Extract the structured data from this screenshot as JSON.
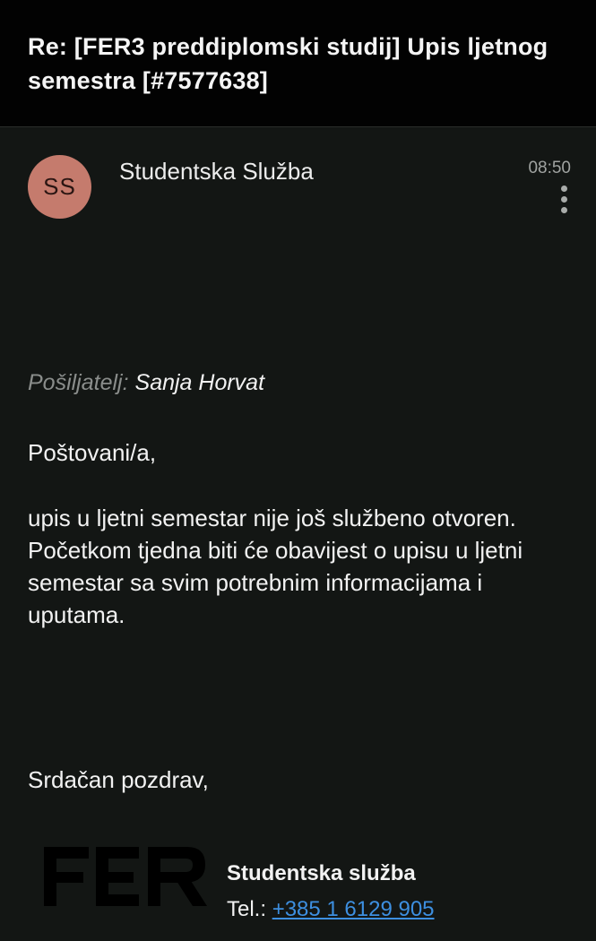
{
  "header": {
    "subject_line1": "Re: [FER3 preddiplomski studij] Upis ljetnog",
    "subject_line2": "semestra [#7577638]"
  },
  "message": {
    "avatar_initials": "SS",
    "avatar_color": "#c57b6d",
    "sender_name": "Studentska Služba",
    "time": "08:50",
    "menu_icon": "more-vertical-icon",
    "from_label": "Pošiljatelj:",
    "from_value": "Sanja Horvat",
    "greeting": "Poštovani/a,",
    "body": "upis u ljetni semestar nije još službeno otvoren. Početkom tjedna biti će obavijest o upisu u ljetni semestar sa svim potrebnim informacijama i uputama.",
    "closing": "Srdačan pozdrav,"
  },
  "signature": {
    "logo_text": "FER",
    "org": "Studentska služba",
    "tel_label": "Tel.:",
    "tel_number": "+385 1 6129 905",
    "link_color": "#3d8fe0"
  }
}
